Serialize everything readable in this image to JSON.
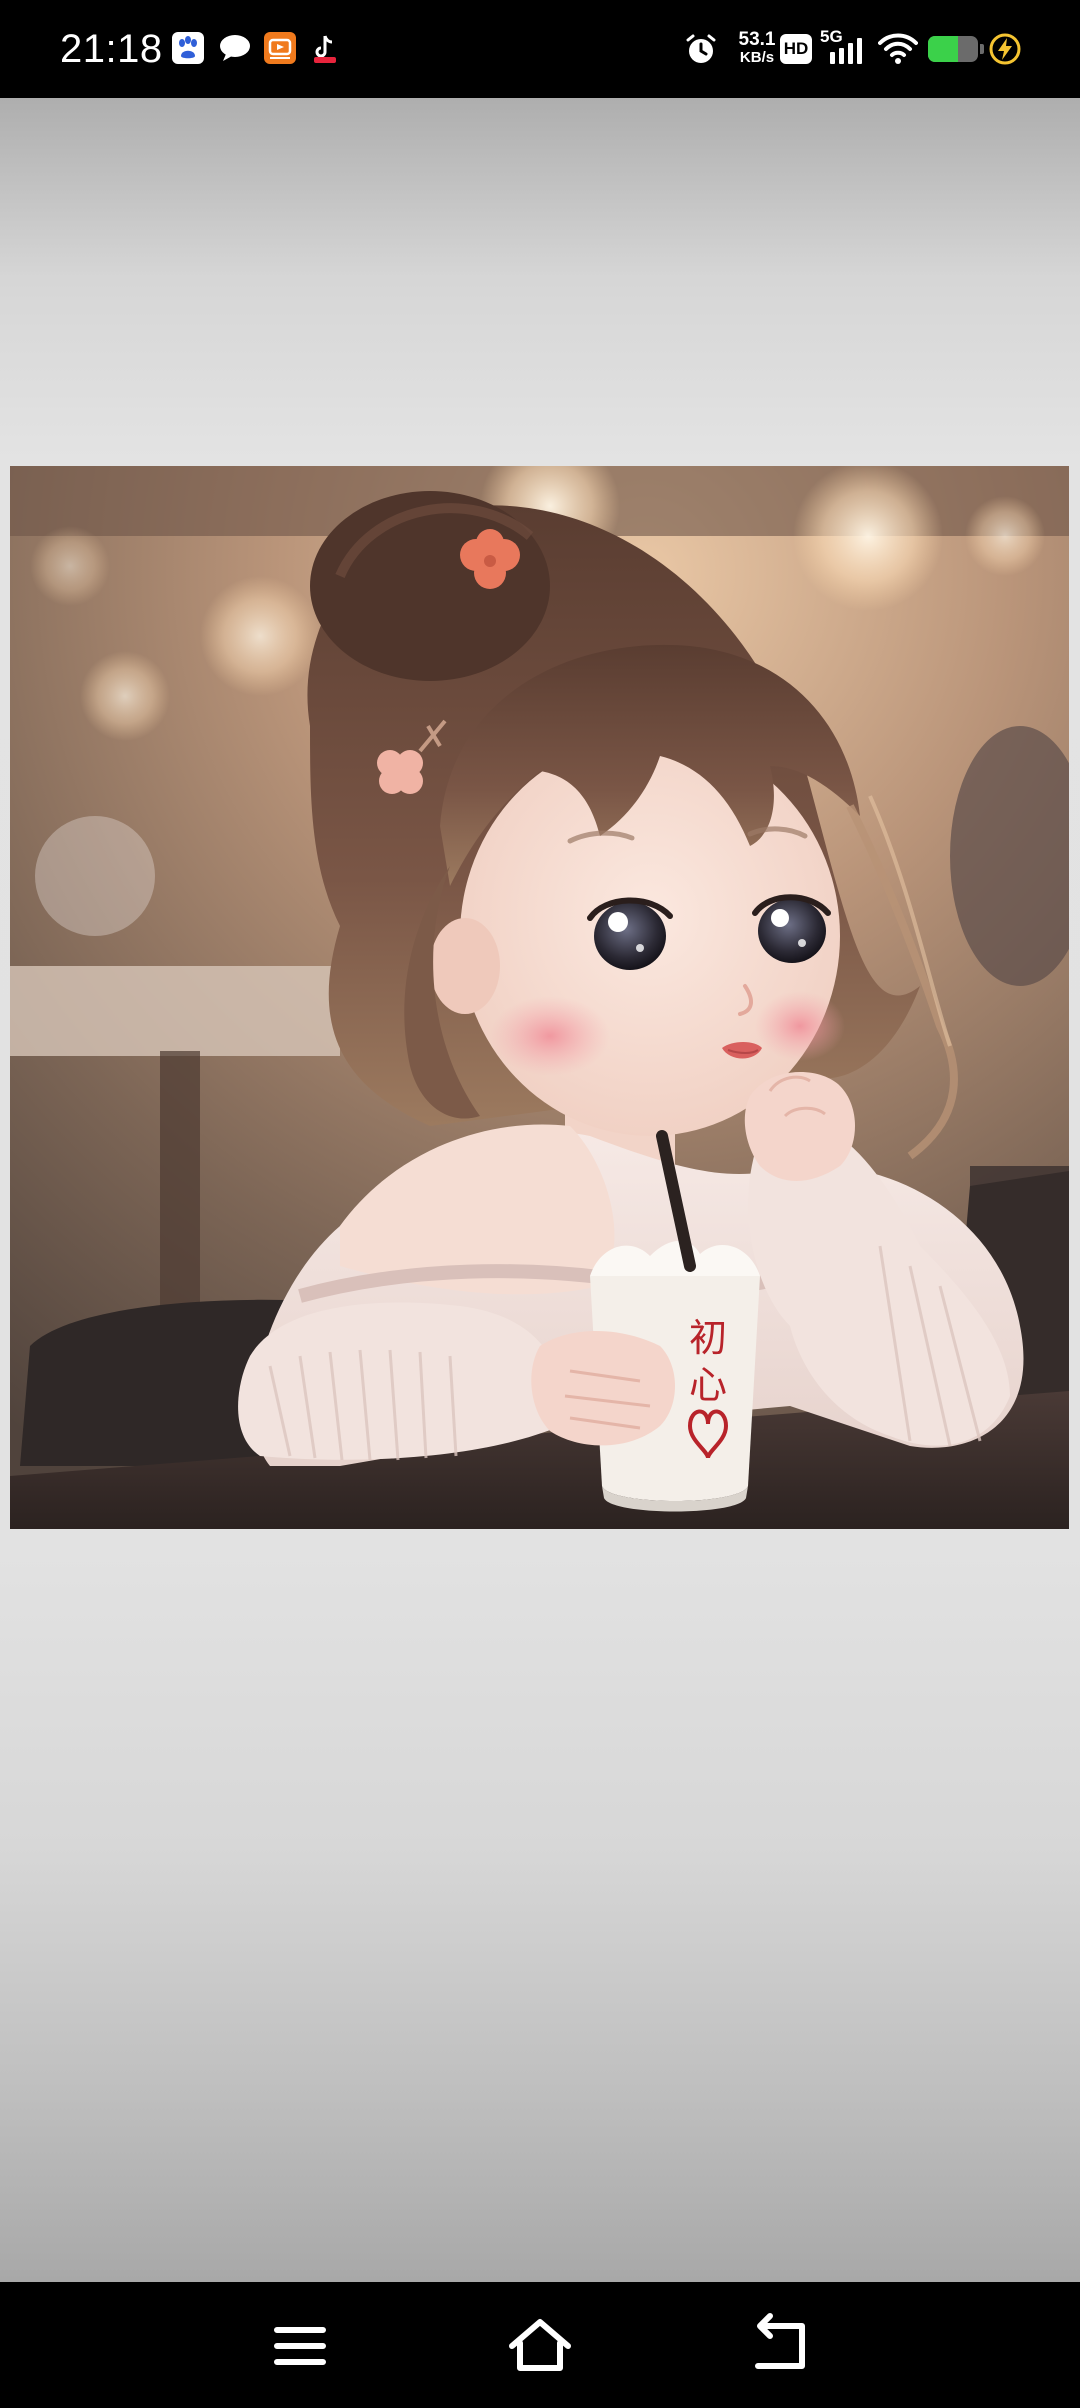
{
  "status_bar": {
    "time": "21:18",
    "notification_icons": [
      "baidu-app-icon",
      "chat-bubble-icon",
      "video-app-icon",
      "tiktok-icon"
    ],
    "network_speed_value": "53.1",
    "network_speed_unit": "KB/s",
    "hd_badge": "HD",
    "network_type": "5G",
    "battery_level": 0.6,
    "charging": true
  },
  "photo": {
    "cup_text_line1": "初",
    "cup_text_line2": "心"
  },
  "nav_bar": {
    "buttons": [
      "menu-icon",
      "home-icon",
      "back-icon"
    ]
  },
  "colors": {
    "battery_fill": "#3bd14a",
    "charging_bolt": "#f5c431",
    "cup_text": "#b8232a"
  }
}
